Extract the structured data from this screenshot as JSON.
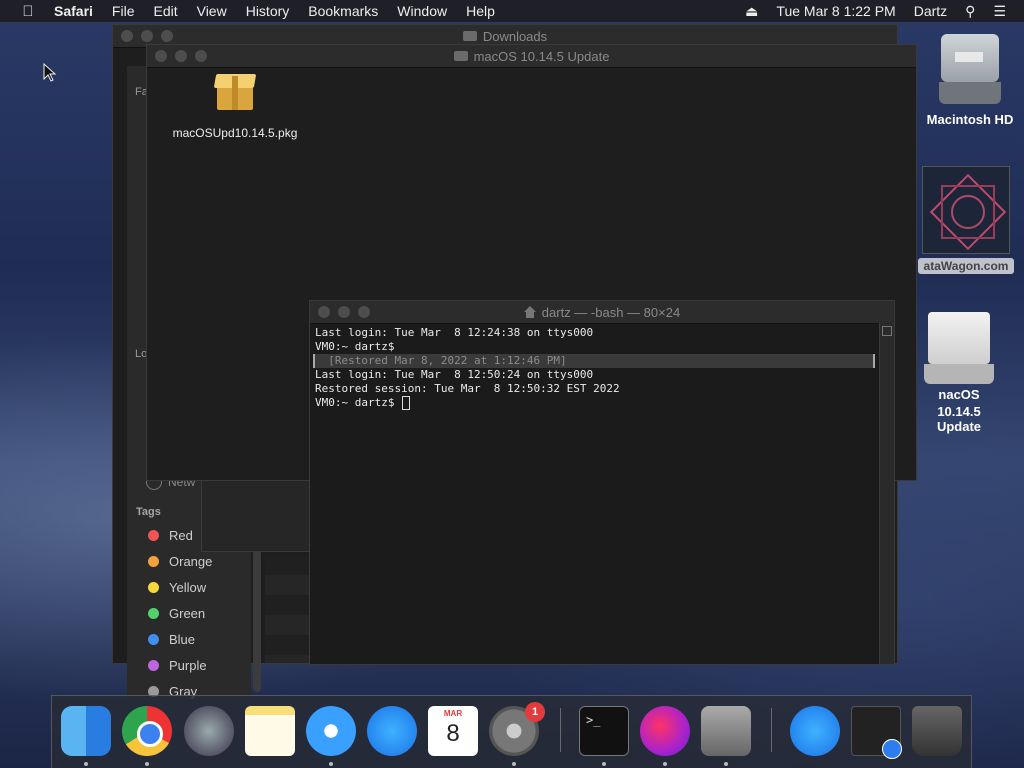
{
  "menubar": {
    "app": "Safari",
    "items": [
      "File",
      "Edit",
      "View",
      "History",
      "Bookmarks",
      "Window",
      "Help"
    ],
    "clock": "Tue Mar 8  1:22 PM",
    "user": "Dartz",
    "icons": [
      "apple-icon",
      "eject-icon",
      "search-icon",
      "list-icon"
    ]
  },
  "finder_back": {
    "title": "Downloads",
    "sidebar_fragments": {
      "favorites": "Fa",
      "locations": "Lo",
      "network": "Netw"
    },
    "tags_label": "Tags",
    "tags": [
      {
        "name": "Red",
        "color": "#f05454"
      },
      {
        "name": "Orange",
        "color": "#f4a23b"
      },
      {
        "name": "Yellow",
        "color": "#f5d93a"
      },
      {
        "name": "Green",
        "color": "#52d26a"
      },
      {
        "name": "Blue",
        "color": "#3e8ff0"
      },
      {
        "name": "Purple",
        "color": "#c064e0"
      },
      {
        "name": "Gray",
        "color": "#9a9a9a"
      }
    ]
  },
  "finder_front": {
    "title": "macOS 10.14.5 Update",
    "file_name": "macOSUpd10.14.5.pkg"
  },
  "terminal": {
    "title": "dartz — -bash — 80×24",
    "lines": [
      "Last login: Tue Mar  8 12:24:38 on ttys000",
      "VM0:~ dartz$",
      "  [Restored Mar 8, 2022 at 1:12:46 PM]",
      "Last login: Tue Mar  8 12:50:24 on ttys000",
      "Restored session: Tue Mar  8 12:50:32 EST 2022",
      "VM0:~ dartz$ "
    ]
  },
  "desktop": {
    "hd_label": "Macintosh HD",
    "datawagon_label": "ataWagon.com",
    "dmg_label_1": "nacOS 10.14.5",
    "dmg_label_2": "Update"
  },
  "dock": {
    "calendar_month": "MAR",
    "calendar_day": "8",
    "prefs_badge": "1",
    "terminal_glyph": ">_"
  }
}
